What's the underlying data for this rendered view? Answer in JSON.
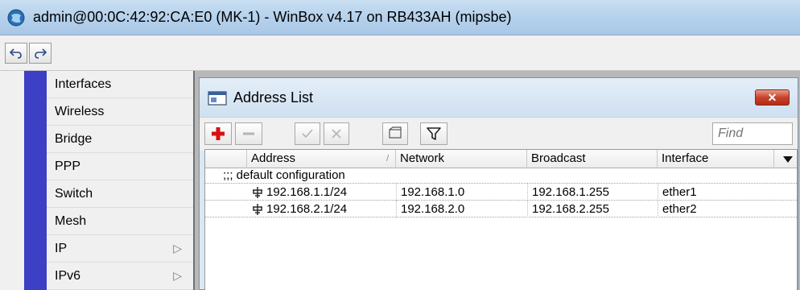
{
  "window": {
    "title": "admin@00:0C:42:92:CA:E0 (MK-1) - WinBox v4.17 on RB433AH (mipsbe)",
    "icon": "winbox-app-icon"
  },
  "toolbar": {
    "undo_icon": "undo-icon",
    "redo_icon": "redo-icon"
  },
  "menu": {
    "items": [
      {
        "label": "Interfaces",
        "has_submenu": false
      },
      {
        "label": "Wireless",
        "has_submenu": false
      },
      {
        "label": "Bridge",
        "has_submenu": false
      },
      {
        "label": "PPP",
        "has_submenu": false
      },
      {
        "label": "Switch",
        "has_submenu": false
      },
      {
        "label": "Mesh",
        "has_submenu": false
      },
      {
        "label": "IP",
        "has_submenu": true
      },
      {
        "label": "IPv6",
        "has_submenu": true
      }
    ],
    "submenu_arrow": "▷"
  },
  "address_list": {
    "title": "Address List",
    "close_label": "✕",
    "find_placeholder": "Find",
    "columns": {
      "address": "Address",
      "sort_mark": "/",
      "network": "Network",
      "broadcast": "Broadcast",
      "interface": "Interface"
    },
    "group_comment": ";;; default configuration",
    "rows": [
      {
        "address": "192.168.1.1/24",
        "network": "192.168.1.0",
        "broadcast": "192.168.1.255",
        "interface": "ether1"
      },
      {
        "address": "192.168.2.1/24",
        "network": "192.168.2.0",
        "broadcast": "192.168.2.255",
        "interface": "ether2"
      }
    ]
  },
  "colors": {
    "brand_strip": "#3d3fc4",
    "add_red": "#d81010",
    "close_red": "#c6432b"
  }
}
